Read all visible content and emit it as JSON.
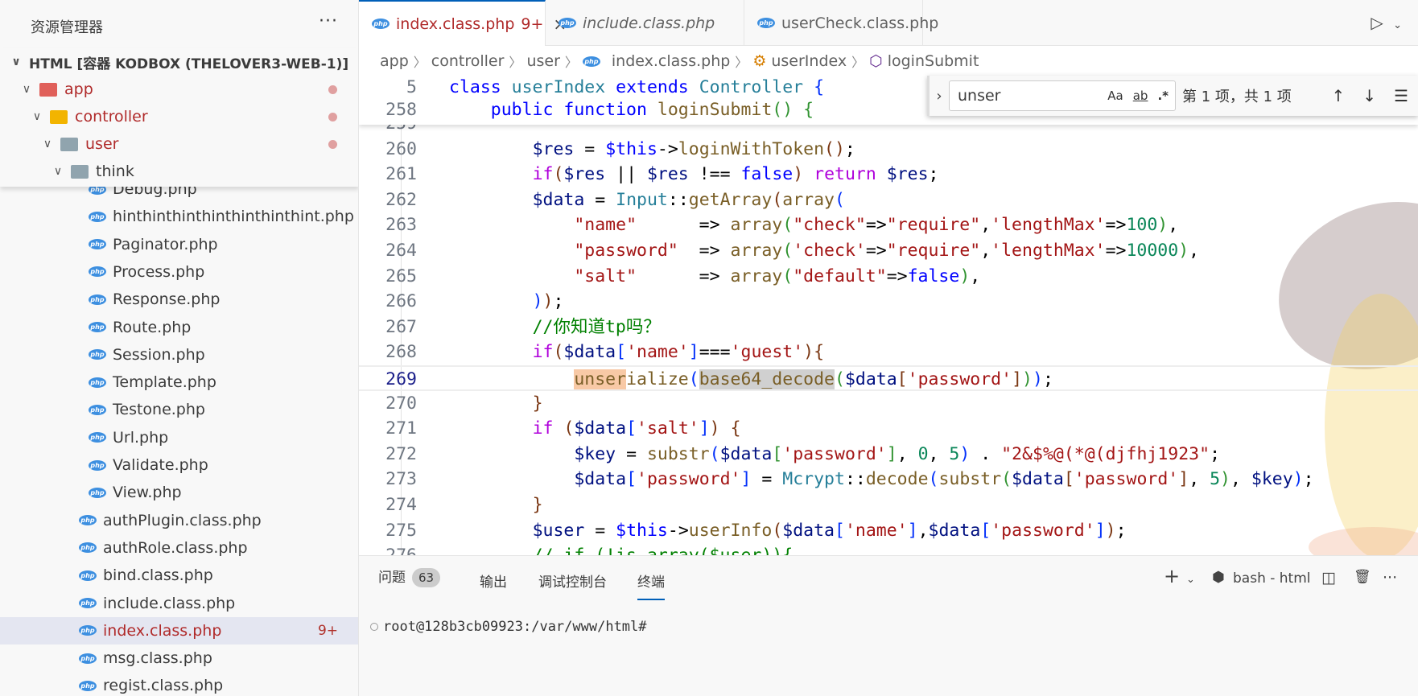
{
  "sidebar": {
    "title": "资源管理器",
    "more": "···",
    "root": "HTML [容器 KODBOX (THELOVER3-WEB-1)]",
    "sticky": [
      {
        "label": "app",
        "level": 1,
        "folder_color": "#e0605a",
        "modified": true
      },
      {
        "label": "controller",
        "level": 2,
        "folder_color": "#f2b400",
        "modified": true
      },
      {
        "label": "user",
        "level": 3,
        "folder_color": "#90a4ae",
        "modified": true
      },
      {
        "label": "think",
        "level": 4,
        "folder_color": "#90a4ae",
        "modified": false
      }
    ],
    "files": [
      {
        "label": "Debug.php",
        "level": 5
      },
      {
        "label": "hinthinthinthinthinthinthint.php",
        "level": 5
      },
      {
        "label": "Paginator.php",
        "level": 5
      },
      {
        "label": "Process.php",
        "level": 5
      },
      {
        "label": "Response.php",
        "level": 5
      },
      {
        "label": "Route.php",
        "level": 5
      },
      {
        "label": "Session.php",
        "level": 5
      },
      {
        "label": "Template.php",
        "level": 5
      },
      {
        "label": "Testone.php",
        "level": 5
      },
      {
        "label": "Url.php",
        "level": 5
      },
      {
        "label": "Validate.php",
        "level": 5
      },
      {
        "label": "View.php",
        "level": 5
      },
      {
        "label": "authPlugin.class.php",
        "level": 4
      },
      {
        "label": "authRole.class.php",
        "level": 4
      },
      {
        "label": "bind.class.php",
        "level": 4
      },
      {
        "label": "include.class.php",
        "level": 4
      },
      {
        "label": "index.class.php",
        "level": 4,
        "selected": true,
        "badge": "9+"
      },
      {
        "label": "msg.class.php",
        "level": 4
      },
      {
        "label": "regist.class.php",
        "level": 4
      }
    ]
  },
  "tabs": [
    {
      "label": "index.class.php",
      "badge": "9+",
      "active": true,
      "close": "×"
    },
    {
      "label": "include.class.php",
      "italic": true
    },
    {
      "label": "userCheck.class.php"
    }
  ],
  "tab_actions": {
    "run": "▷",
    "dropdown": "⌄"
  },
  "breadcrumbs": [
    "app",
    "controller",
    "user",
    "index.class.php",
    "userIndex",
    "loginSubmit"
  ],
  "find": {
    "value": "unser",
    "match_case": "Aa",
    "whole_word": "ab",
    "regex": ".*",
    "result": "第 1 项，共 1 项",
    "prev": "↑",
    "next": "↓",
    "menu": "☰"
  },
  "code": {
    "sticky": [
      {
        "n": "5",
        "tokens": [
          [
            "kw",
            "class "
          ],
          [
            "cls",
            "userIndex "
          ],
          [
            "kw",
            "extends "
          ],
          [
            "cls",
            "Controller "
          ],
          [
            "b1",
            "{"
          ]
        ]
      },
      {
        "n": "258",
        "tokens": [
          [
            "op",
            "    "
          ],
          [
            "kw",
            "public function "
          ],
          [
            "fn",
            "loginSubmit"
          ],
          [
            "b2",
            "() "
          ],
          [
            "b2",
            "{"
          ]
        ]
      }
    ],
    "lines": [
      {
        "n": "259",
        "tokens": []
      },
      {
        "n": "260",
        "tokens": [
          [
            "op",
            "        "
          ],
          [
            "var",
            "$res"
          ],
          [
            "op",
            " = "
          ],
          [
            "kw",
            "$this"
          ],
          [
            "op",
            "->"
          ],
          [
            "fn",
            "loginWithToken"
          ],
          [
            "b3",
            "()"
          ],
          [
            "op",
            ";"
          ]
        ]
      },
      {
        "n": "261",
        "tokens": [
          [
            "op",
            "        "
          ],
          [
            "ctl",
            "if"
          ],
          [
            "b3",
            "("
          ],
          [
            "var",
            "$res"
          ],
          [
            "op",
            " || "
          ],
          [
            "var",
            "$res"
          ],
          [
            "op",
            " !== "
          ],
          [
            "kw",
            "false"
          ],
          [
            "b3",
            ")"
          ],
          [
            "op",
            " "
          ],
          [
            "ctl",
            "return"
          ],
          [
            "op",
            " "
          ],
          [
            "var",
            "$res"
          ],
          [
            "op",
            ";"
          ]
        ]
      },
      {
        "n": "262",
        "tokens": [
          [
            "op",
            "        "
          ],
          [
            "var",
            "$data"
          ],
          [
            "op",
            " = "
          ],
          [
            "cls",
            "Input"
          ],
          [
            "op",
            "::"
          ],
          [
            "fn",
            "getArray"
          ],
          [
            "b3",
            "("
          ],
          [
            "fn",
            "array"
          ],
          [
            "b1",
            "("
          ]
        ]
      },
      {
        "n": "263",
        "tokens": [
          [
            "op",
            "            "
          ],
          [
            "str",
            "\"name\""
          ],
          [
            "op",
            "      => "
          ],
          [
            "fn",
            "array"
          ],
          [
            "b2",
            "("
          ],
          [
            "str",
            "\"check\""
          ],
          [
            "op",
            "=>"
          ],
          [
            "str",
            "\"require\""
          ],
          [
            "op",
            ","
          ],
          [
            "str",
            "'lengthMax'"
          ],
          [
            "op",
            "=>"
          ],
          [
            "num",
            "100"
          ],
          [
            "b2",
            ")"
          ],
          [
            "op",
            ","
          ]
        ]
      },
      {
        "n": "264",
        "tokens": [
          [
            "op",
            "            "
          ],
          [
            "str",
            "\"password\""
          ],
          [
            "op",
            "  => "
          ],
          [
            "fn",
            "array"
          ],
          [
            "b2",
            "("
          ],
          [
            "str",
            "'check'"
          ],
          [
            "op",
            "=>"
          ],
          [
            "str",
            "\"require\""
          ],
          [
            "op",
            ","
          ],
          [
            "str",
            "'lengthMax'"
          ],
          [
            "op",
            "=>"
          ],
          [
            "num",
            "10000"
          ],
          [
            "b2",
            ")"
          ],
          [
            "op",
            ","
          ]
        ]
      },
      {
        "n": "265",
        "tokens": [
          [
            "op",
            "            "
          ],
          [
            "str",
            "\"salt\""
          ],
          [
            "op",
            "      => "
          ],
          [
            "fn",
            "array"
          ],
          [
            "b2",
            "("
          ],
          [
            "str",
            "\"default\""
          ],
          [
            "op",
            "=>"
          ],
          [
            "kw",
            "false"
          ],
          [
            "b2",
            ")"
          ],
          [
            "op",
            ","
          ]
        ]
      },
      {
        "n": "266",
        "tokens": [
          [
            "op",
            "        "
          ],
          [
            "b1",
            ")"
          ],
          [
            "b3",
            ")"
          ],
          [
            "op",
            ";"
          ]
        ]
      },
      {
        "n": "267",
        "tokens": [
          [
            "op",
            "        "
          ],
          [
            "cm",
            "//你知道tp吗？"
          ]
        ]
      },
      {
        "n": "268",
        "tokens": [
          [
            "op",
            "        "
          ],
          [
            "ctl",
            "if"
          ],
          [
            "b3",
            "("
          ],
          [
            "var",
            "$data"
          ],
          [
            "b1",
            "["
          ],
          [
            "str",
            "'name'"
          ],
          [
            "b1",
            "]"
          ],
          [
            "op",
            "==="
          ],
          [
            "str",
            "'guest'"
          ],
          [
            "b3",
            ")"
          ],
          [
            "b3",
            "{"
          ]
        ]
      },
      {
        "n": "269",
        "current": true,
        "tokens": [
          [
            "op",
            "            "
          ],
          [
            "fn hl-find",
            "unser"
          ],
          [
            "fn",
            "ialize"
          ],
          [
            "b1",
            "("
          ],
          [
            "fn hl-word",
            "base64_decode"
          ],
          [
            "b2",
            "("
          ],
          [
            "var",
            "$data"
          ],
          [
            "b3",
            "["
          ],
          [
            "str",
            "'password'"
          ],
          [
            "b3",
            "]"
          ],
          [
            "b2",
            ")"
          ],
          [
            "b1",
            ")"
          ],
          [
            "op",
            ";"
          ]
        ]
      },
      {
        "n": "270",
        "tokens": [
          [
            "op",
            "        "
          ],
          [
            "b3",
            "}"
          ]
        ]
      },
      {
        "n": "271",
        "tokens": [
          [
            "op",
            "        "
          ],
          [
            "ctl",
            "if "
          ],
          [
            "b3",
            "("
          ],
          [
            "var",
            "$data"
          ],
          [
            "b1",
            "["
          ],
          [
            "str",
            "'salt'"
          ],
          [
            "b1",
            "]"
          ],
          [
            "b3",
            ")"
          ],
          [
            "op",
            " "
          ],
          [
            "b3",
            "{"
          ]
        ]
      },
      {
        "n": "272",
        "tokens": [
          [
            "op",
            "            "
          ],
          [
            "var",
            "$key"
          ],
          [
            "op",
            " = "
          ],
          [
            "fn",
            "substr"
          ],
          [
            "b1",
            "("
          ],
          [
            "var",
            "$data"
          ],
          [
            "b2",
            "["
          ],
          [
            "str",
            "'password'"
          ],
          [
            "b2",
            "]"
          ],
          [
            "op",
            ", "
          ],
          [
            "num",
            "0"
          ],
          [
            "op",
            ", "
          ],
          [
            "num",
            "5"
          ],
          [
            "b1",
            ")"
          ],
          [
            "op",
            " . "
          ],
          [
            "str",
            "\"2&$%@(*@(djfhj1923\""
          ],
          [
            "op",
            ";"
          ]
        ]
      },
      {
        "n": "273",
        "tokens": [
          [
            "op",
            "            "
          ],
          [
            "var",
            "$data"
          ],
          [
            "b1",
            "["
          ],
          [
            "str",
            "'password'"
          ],
          [
            "b1",
            "]"
          ],
          [
            "op",
            " = "
          ],
          [
            "cls",
            "Mcrypt"
          ],
          [
            "op",
            "::"
          ],
          [
            "fn",
            "decode"
          ],
          [
            "b1",
            "("
          ],
          [
            "fn",
            "substr"
          ],
          [
            "b2",
            "("
          ],
          [
            "var",
            "$data"
          ],
          [
            "b3",
            "["
          ],
          [
            "str",
            "'password'"
          ],
          [
            "b3",
            "]"
          ],
          [
            "op",
            ", "
          ],
          [
            "num",
            "5"
          ],
          [
            "b2",
            ")"
          ],
          [
            "op",
            ", "
          ],
          [
            "var",
            "$key"
          ],
          [
            "b1",
            ")"
          ],
          [
            "op",
            ";"
          ]
        ]
      },
      {
        "n": "274",
        "tokens": [
          [
            "op",
            "        "
          ],
          [
            "b3",
            "}"
          ]
        ]
      },
      {
        "n": "275",
        "tokens": [
          [
            "op",
            "        "
          ],
          [
            "var",
            "$user"
          ],
          [
            "op",
            " = "
          ],
          [
            "kw",
            "$this"
          ],
          [
            "op",
            "->"
          ],
          [
            "fn",
            "userInfo"
          ],
          [
            "b3",
            "("
          ],
          [
            "var",
            "$data"
          ],
          [
            "b1",
            "["
          ],
          [
            "str",
            "'name'"
          ],
          [
            "b1",
            "]"
          ],
          [
            "op",
            ","
          ],
          [
            "var",
            "$data"
          ],
          [
            "b1",
            "["
          ],
          [
            "str",
            "'password'"
          ],
          [
            "b1",
            "]"
          ],
          [
            "b3",
            ")"
          ],
          [
            "op",
            ";"
          ]
        ]
      },
      {
        "n": "276",
        "tokens": [
          [
            "op",
            "        "
          ],
          [
            "cm",
            "// if (!is_array($user)){"
          ]
        ]
      }
    ]
  },
  "panel": {
    "tabs": [
      {
        "label": "问题",
        "badge": "63"
      },
      {
        "label": "输出"
      },
      {
        "label": "调试控制台"
      },
      {
        "label": "终端",
        "active": true
      }
    ],
    "actions": {
      "add": "+",
      "dropdown": "⌄",
      "terminal_name": "bash - html",
      "split": "◫",
      "trash": "🗑",
      "more": "···"
    },
    "terminal_prompt": "root@128b3cb09923:/var/www/html#"
  },
  "colors": {
    "accent": "#005fb8",
    "modified": "#b02a2a",
    "find_highlight": "#f8c9a6"
  }
}
